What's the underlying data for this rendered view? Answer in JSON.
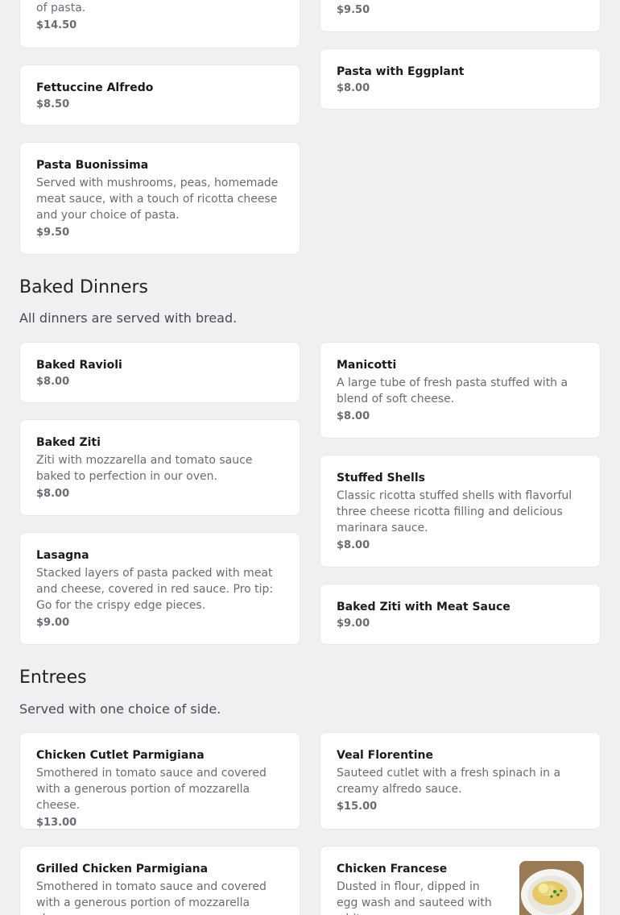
{
  "top": {
    "left_cut_desc": "of pasta.",
    "left_cut_price": "$14.50",
    "right_cut_price": "$9.50"
  },
  "pasta": {
    "items": [
      {
        "name": "Fettuccine Alfredo",
        "price": "$8.50"
      },
      {
        "name": "Pasta with Eggplant",
        "price": "$8.00"
      },
      {
        "name": "Pasta Buonissima",
        "desc": "Served with mushrooms, peas, homemade meat sauce, with a touch of ricotta cheese and your choice of pasta.",
        "price": "$9.50"
      }
    ]
  },
  "baked": {
    "title": "Baked Dinners",
    "subtitle": "All dinners are served with bread.",
    "items": [
      {
        "name": "Baked Ravioli",
        "price": "$8.00"
      },
      {
        "name": "Manicotti",
        "desc": "A large tube of fresh pasta stuffed with a blend of soft cheese.",
        "price": "$8.00"
      },
      {
        "name": "Baked Ziti",
        "desc": "Ziti with mozzarella and tomato sauce baked to perfection in our oven.",
        "price": "$8.00"
      },
      {
        "name": "Stuffed Shells",
        "desc": "Classic ricotta stuffed shells with flavorful three cheese ricotta filling and delicious marinara sauce.",
        "price": "$8.00"
      },
      {
        "name": "Lasagna",
        "desc": "Stacked layers of pasta packed with meat and cheese, covered in red sauce. Pro tip: Go for the crispy edge pieces.",
        "price": "$9.00"
      },
      {
        "name": "Baked Ziti with Meat Sauce",
        "price": "$9.00"
      }
    ]
  },
  "entrees": {
    "title": "Entrees",
    "subtitle": "Served with one choice of side.",
    "items": [
      {
        "name": "Chicken Cutlet Parmigiana",
        "desc": "Smothered in tomato sauce and covered with a generous portion of mozzarella cheese.",
        "price": "$13.00"
      },
      {
        "name": "Veal Florentine",
        "desc": "Sauteed cutlet with a fresh spinach in a creamy alfredo sauce.",
        "price": "$15.00"
      },
      {
        "name": "Grilled Chicken Parmigiana",
        "desc": "Smothered in tomato sauce and covered with a generous portion of mozzarella cheese."
      },
      {
        "name": "Chicken Francese",
        "desc": "Dusted in flour, dipped in egg wash and sauteed with white",
        "image_icon": "food-photo-icon"
      }
    ]
  }
}
